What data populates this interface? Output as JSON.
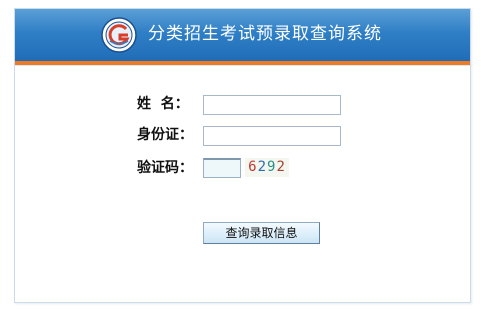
{
  "header": {
    "title": "分类招生考试预录取查询系统",
    "logo_icon": "school-emblem-icon",
    "colors": {
      "header_blue": "#2f7fc6",
      "accent_orange": "#f07a21"
    }
  },
  "form": {
    "name_label": "姓  名：",
    "id_label": "身份证：",
    "captcha_label": "验证码：",
    "name_value": "",
    "id_value": "",
    "captcha_value": "",
    "captcha_digits": [
      "6",
      "2",
      "9",
      "2"
    ],
    "submit_label": "查询录取信息"
  }
}
